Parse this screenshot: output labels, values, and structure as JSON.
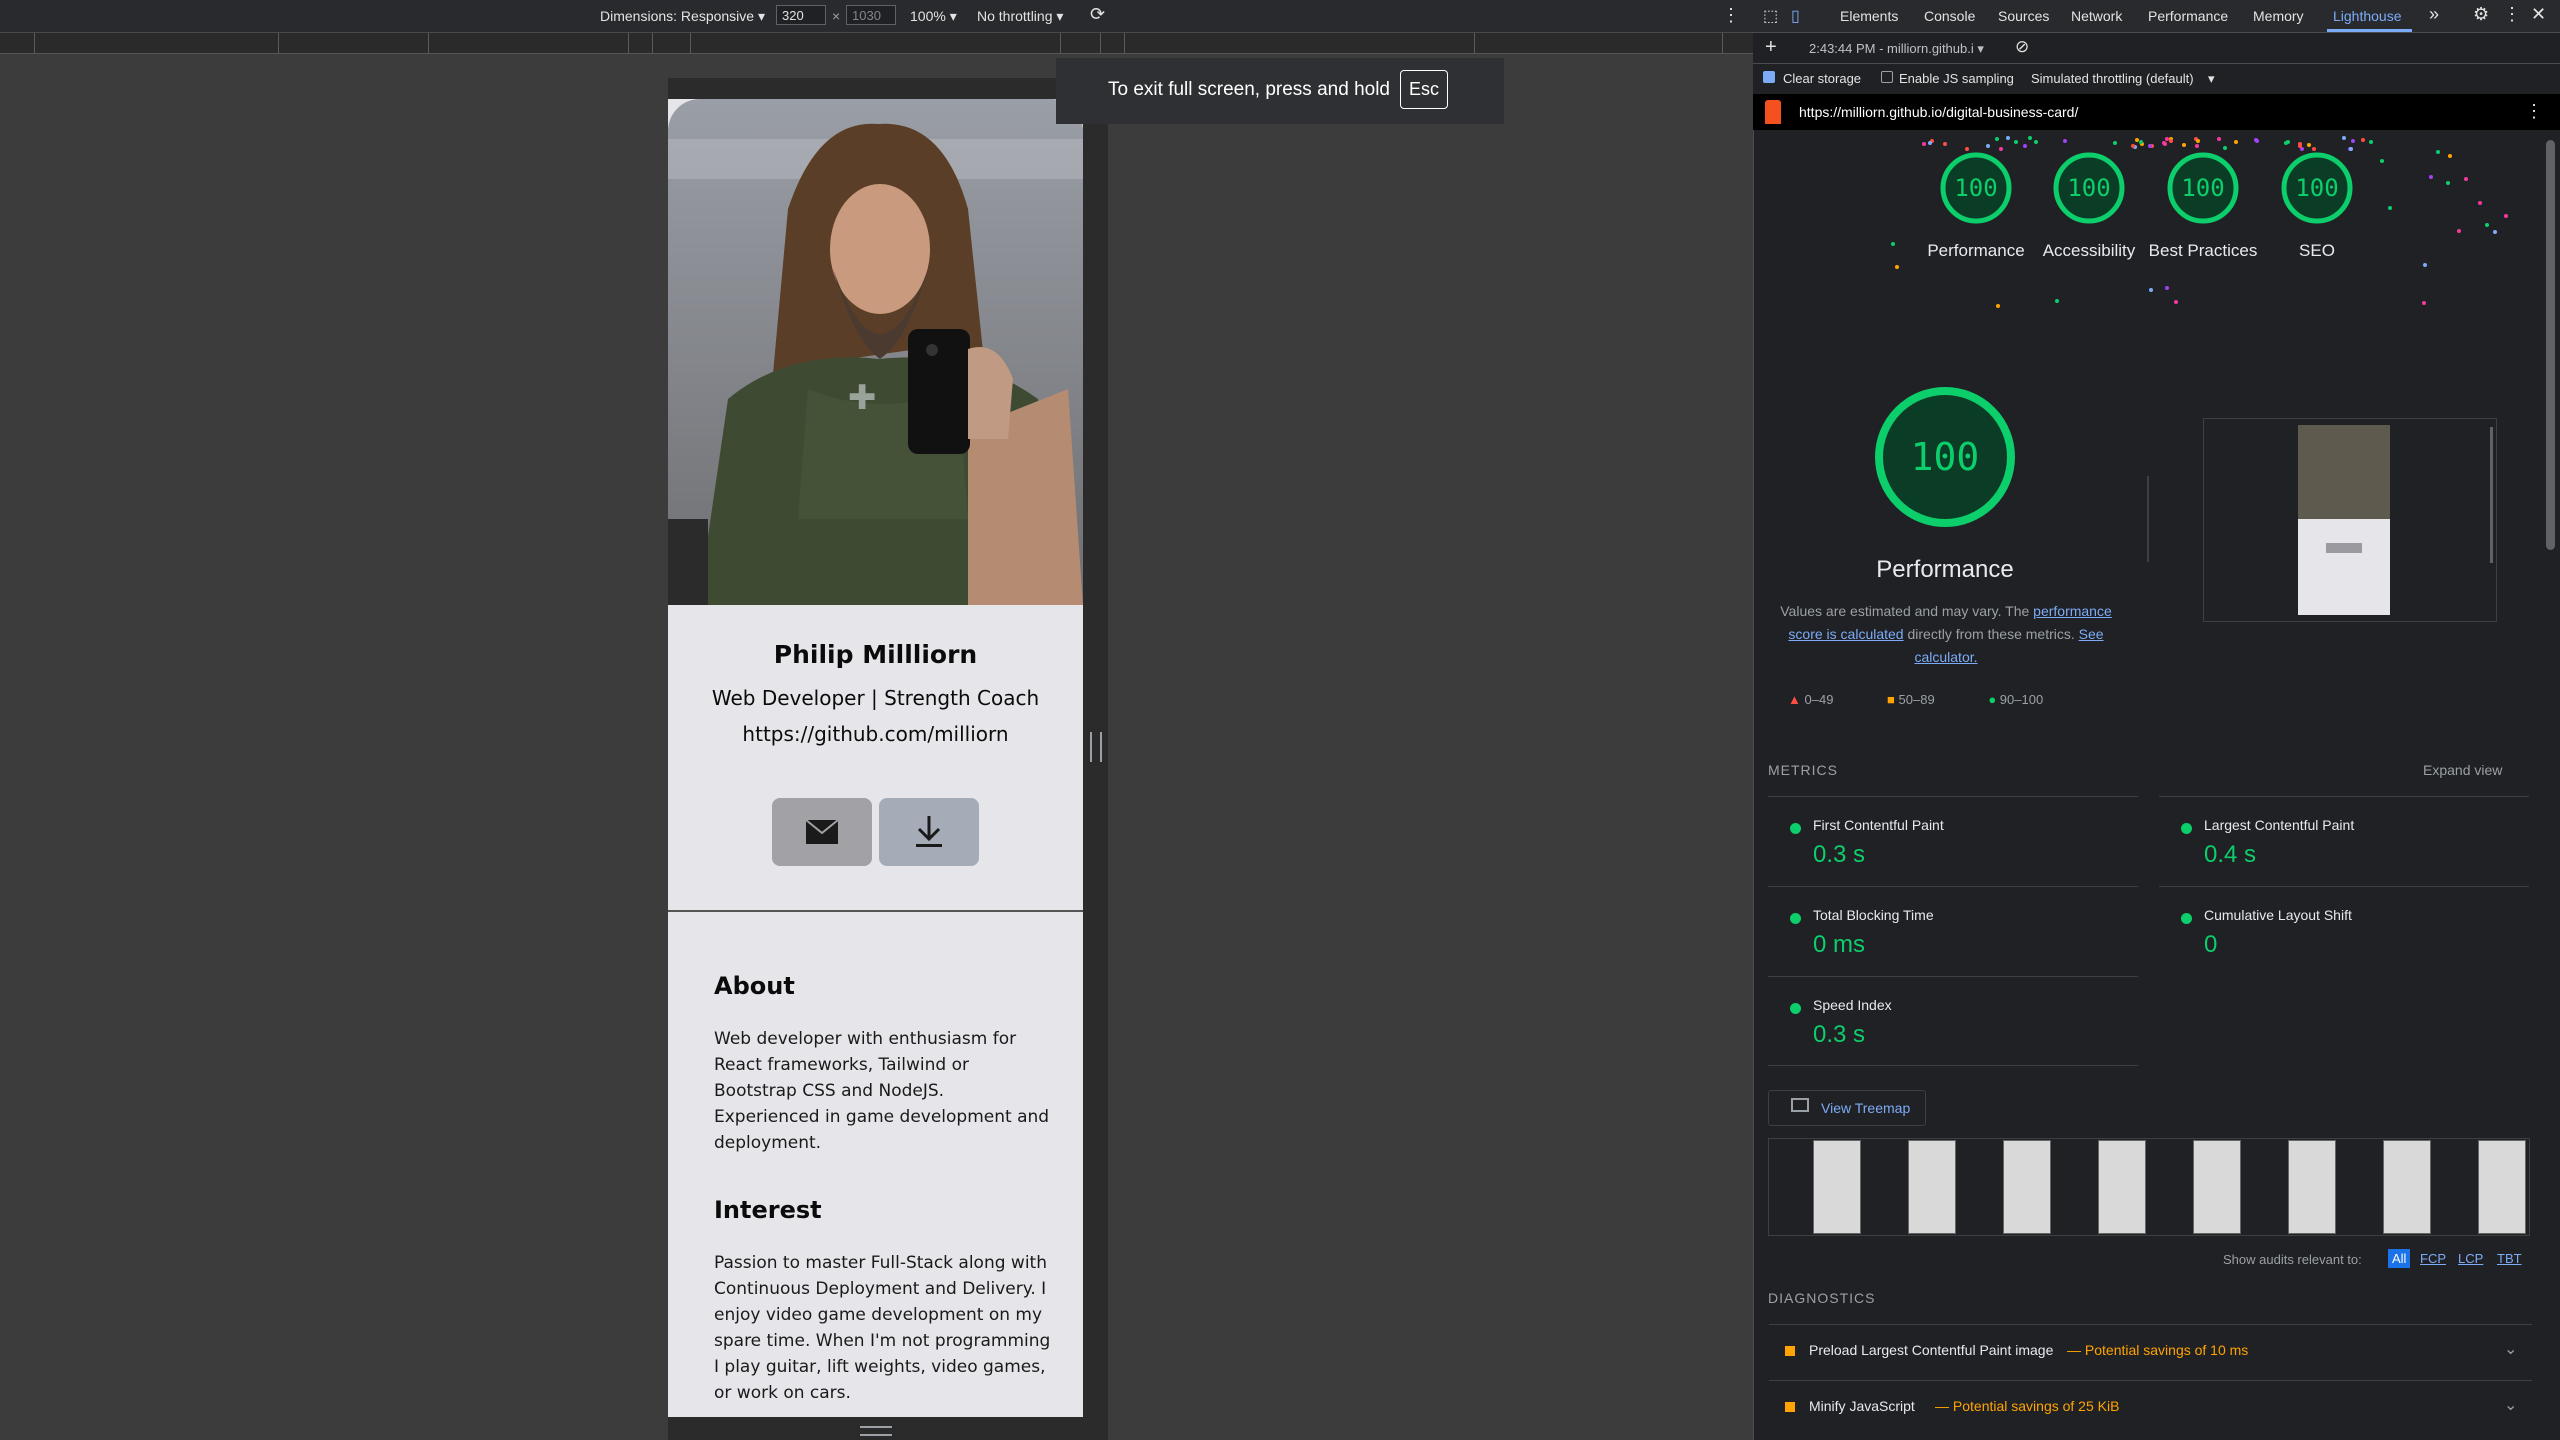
{
  "device_toolbar": {
    "dimensions_label": "Dimensions: Responsive",
    "width_value": "320",
    "height_placeholder": "1030",
    "x_sep": "×",
    "zoom": "100%",
    "throttling": "No throttling"
  },
  "fullscreen_banner": {
    "text": "To exit full screen, press and hold",
    "key": "Esc"
  },
  "card": {
    "name": "Philip Millliorn",
    "title": "Web Developer | Strength Coach",
    "link": "https://github.com/milliorn",
    "about_heading": "About",
    "about_text": "Web developer with enthusiasm for React frameworks, Tailwind or Bootstrap CSS and NodeJS. Experienced in game development and deployment.",
    "interest_heading": "Interest",
    "interest_text": "Passion to master Full-Stack along with Continuous Deployment and Delivery. I enjoy video game development on my spare time. When I'm not programming I play guitar, lift weights, video games, or work on cars."
  },
  "devtools": {
    "tabs": [
      "Elements",
      "Console",
      "Sources",
      "Network",
      "Performance",
      "Memory",
      "Lighthouse"
    ],
    "active_tab": "Lighthouse",
    "report_select": "2:43:44 PM - milliorn.github.i",
    "clear_storage_label": "Clear storage",
    "js_sampling_label": "Enable JS sampling",
    "throttling_label": "Simulated throttling (default)",
    "url": "https://milliorn.github.io/digital-business-card/",
    "scores": [
      {
        "label": "Performance",
        "value": "100"
      },
      {
        "label": "Accessibility",
        "value": "100"
      },
      {
        "label": "Best Practices",
        "value": "100"
      },
      {
        "label": "SEO",
        "value": "100"
      }
    ],
    "perf_score": "100",
    "perf_title": "Performance",
    "perf_note_1": "Values are estimated and may vary. The",
    "perf_note_link1": "performance score is calculated",
    "perf_note_2": "directly from these metrics.",
    "perf_note_link2": "See calculator.",
    "legend": [
      "0–49",
      "50–89",
      "90–100"
    ],
    "metrics_heading": "METRICS",
    "expand_view": "Expand view",
    "metrics": [
      {
        "label": "First Contentful Paint",
        "value": "0.3 s"
      },
      {
        "label": "Largest Contentful Paint",
        "value": "0.4 s"
      },
      {
        "label": "Total Blocking Time",
        "value": "0 ms"
      },
      {
        "label": "Cumulative Layout Shift",
        "value": "0"
      },
      {
        "label": "Speed Index",
        "value": "0.3 s"
      }
    ],
    "view_treemap": "View Treemap",
    "show_audits_label": "Show audits relevant to:",
    "audit_filters": [
      "All",
      "FCP",
      "LCP",
      "TBT"
    ],
    "diagnostics_heading": "DIAGNOSTICS",
    "diagnostics": [
      {
        "title": "Preload Largest Contentful Paint image",
        "savings": "— Potential savings of 10 ms"
      },
      {
        "title": "Minify JavaScript",
        "savings": "— Potential savings of 25 KiB"
      }
    ]
  },
  "colors": {
    "pass_green": "#0cce6b",
    "average_orange": "#ffa400",
    "fail_red": "#ff4e42",
    "link_blue": "#7cacf8"
  }
}
